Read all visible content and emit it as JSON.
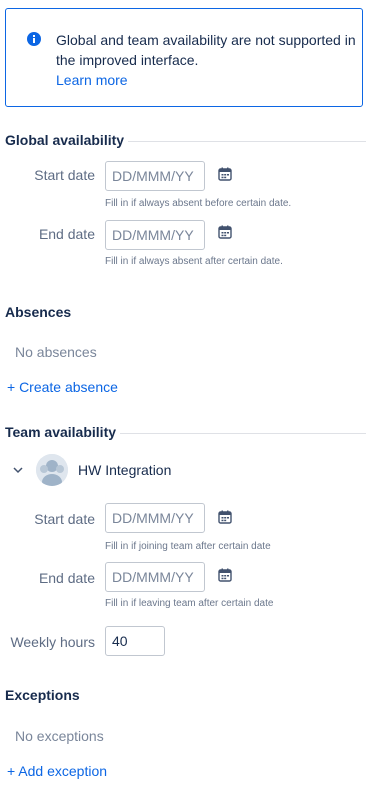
{
  "banner": {
    "message": "Global and team availability are not supported in the improved interface.",
    "link": "Learn more"
  },
  "global": {
    "title": "Global availability",
    "start_label": "Start date",
    "start_placeholder": "DD/MMM/YY",
    "start_help": "Fill in if always absent before certain date.",
    "end_label": "End date",
    "end_placeholder": "DD/MMM/YY",
    "end_help": "Fill in if always absent after certain date."
  },
  "absences": {
    "title": "Absences",
    "empty": "No absences",
    "create": "+ Create absence"
  },
  "team": {
    "title": "Team availability",
    "name": "HW Integration",
    "start_label": "Start date",
    "start_placeholder": "DD/MMM/YY",
    "start_help": "Fill in if joining team after certain date",
    "end_label": "End date",
    "end_placeholder": "DD/MMM/YY",
    "end_help": "Fill in if leaving team after certain date",
    "hours_label": "Weekly hours",
    "hours_value": "40"
  },
  "exceptions": {
    "title": "Exceptions",
    "empty": "No exceptions",
    "add": "+ Add exception"
  },
  "icons": {
    "info": "info-icon",
    "calendar": "calendar-icon",
    "chevron": "chevron-down-icon",
    "avatar": "team-avatar"
  },
  "colors": {
    "accent": "#0c66e4",
    "text": "#172b4d",
    "muted": "#7a869a"
  }
}
